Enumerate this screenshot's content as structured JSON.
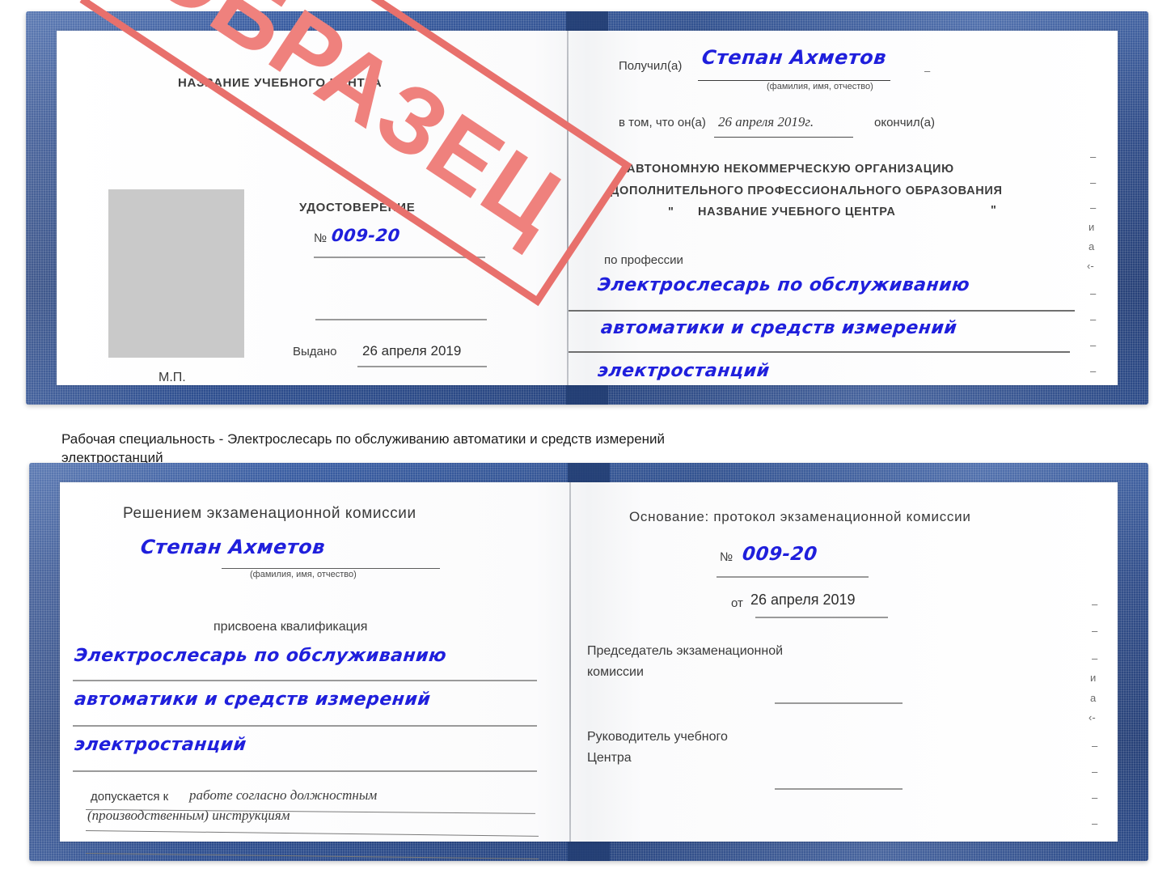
{
  "document": {
    "kind": "Удостоверение",
    "stamp_text": "ОБРАЗЕЦ",
    "stamp_color": "#e8706c",
    "cover_color": "#2b4a8b",
    "ink_color": "#1f1fdc",
    "photo_placeholder_color": "#c9c9c9"
  },
  "caption": {
    "line1": "Рабочая специальность - Электрослесарь по обслуживанию автоматики и средств измерений",
    "line2": "электростанций"
  },
  "cert_top": {
    "left_page": {
      "center_name": "НАЗВАНИЕ УЧЕБНОГО ЦЕНТРА",
      "title": "УДОСТОВЕРЕНИЕ",
      "number_label": "№",
      "number_value": "009-20",
      "issued_label": "Выдано",
      "issued_value": "26 апреля 2019",
      "seal_label": "М.П."
    },
    "right_page": {
      "received_label": "Получил(а)",
      "received_value": "Степан Ахметов",
      "fio_hint": "(фамилия, имя, отчество)",
      "that_he_label": "в том, что он(а)",
      "that_he_value": "26 апреля 2019г.",
      "finished_label": "окончил(а)",
      "org_line1": "АВТОНОМНУЮ НЕКОММЕРЧЕСКУЮ ОРГАНИЗАЦИЮ",
      "org_line2": "ДОПОЛНИТЕЛЬНОГО ПРОФЕССИОНАЛЬНОГО ОБРАЗОВАНИЯ",
      "org_quote_open": "\"",
      "org_line3": "НАЗВАНИЕ УЧЕБНОГО ЦЕНТРА",
      "org_quote_close": "\"",
      "profession_label": "по профессии",
      "profession_line1": "Электрослесарь по обслуживанию",
      "profession_line2": "автоматики и средств измерений",
      "profession_line3": "электростанций",
      "edge_marks": [
        "–",
        "–",
        "–",
        "и",
        "а",
        "‹-",
        "–",
        "–",
        "–",
        "–"
      ]
    }
  },
  "cert_bottom": {
    "left_page": {
      "heading": "Решением экзаменационной комиссии",
      "name_value": "Степан Ахметов",
      "fio_hint": "(фамилия, имя, отчество)",
      "qualification_label": "присвоена квалификация",
      "qual_line1": "Электрослесарь по обслуживанию",
      "qual_line2": "автоматики и средств измерений",
      "qual_line3": "электростанций",
      "admitted_label": "допускается к",
      "admitted_value_line1": "работе согласно должностным",
      "admitted_value_line2": "(производственным) инструкциям"
    },
    "right_page": {
      "basis_label": "Основание: протокол экзаменационной комиссии",
      "number_label": "№",
      "number_value": "009-20",
      "date_label": "от",
      "date_value": "26 апреля 2019",
      "chairman_line1": "Председатель экзаменационной",
      "chairman_line2": "комиссии",
      "head_line1": "Руководитель учебного",
      "head_line2": "Центра",
      "edge_marks": [
        "–",
        "–",
        "–",
        "и",
        "а",
        "‹-",
        "–",
        "–",
        "–",
        "–"
      ]
    }
  }
}
